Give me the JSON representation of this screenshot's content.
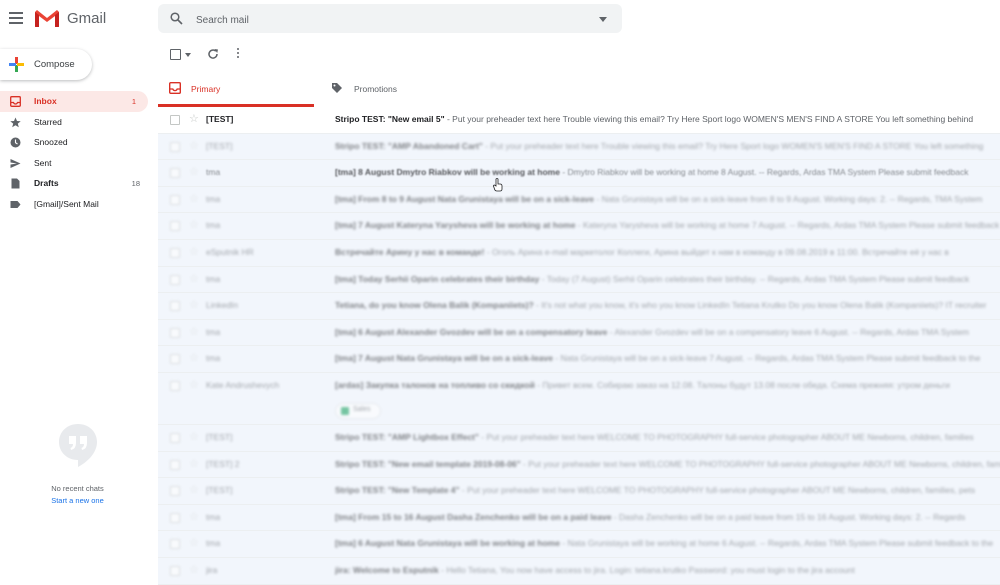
{
  "header": {
    "app_name": "Gmail",
    "search_placeholder": "Search mail"
  },
  "sidebar": {
    "compose_label": "Compose",
    "items": [
      {
        "label": "Inbox",
        "count": "1",
        "icon": "inbox-icon"
      },
      {
        "label": "Starred",
        "count": "",
        "icon": "star-icon"
      },
      {
        "label": "Snoozed",
        "count": "",
        "icon": "clock-icon"
      },
      {
        "label": "Sent",
        "count": "",
        "icon": "send-icon"
      },
      {
        "label": "Drafts",
        "count": "18",
        "icon": "file-icon"
      },
      {
        "label": "[Gmail]/Sent Mail",
        "count": "",
        "icon": "label-icon"
      }
    ],
    "chat": {
      "empty_text": "No recent chats",
      "link_text": "Start a new one"
    }
  },
  "tabs": [
    {
      "label": "Primary",
      "icon": "inbox-icon"
    },
    {
      "label": "Promotions",
      "icon": "tag-icon"
    }
  ],
  "colors": {
    "accent": "#d93025",
    "link": "#1a73e8",
    "active_bg": "#fce8e6"
  },
  "emails": [
    {
      "sender": "[TEST]",
      "subject": "Stripo TEST: \"New email 5\"",
      "snippet": " - Put your preheader text here Trouble viewing this email? Try Here Sport logo WOMEN'S MEN'S FIND A STORE You left something behind"
    },
    {
      "sender": "[TEST]",
      "subject": "Stripo TEST: \"AMP Abandoned Cart\"",
      "snippet": " - Put your preheader text here Trouble viewing this email? Try Here Sport logo WOMEN'S MEN'S FIND A STORE You left something"
    },
    {
      "sender": "tma",
      "subject": "[tma] 8 August Dmytro Riabkov will be working at home",
      "snippet": " - Dmytro Riabkov will be working at home 8 August. -- Regards, Ardas TMA System Please submit feedback"
    },
    {
      "sender": "tma",
      "subject": "[tma] From 8 to 9 August Nata Grunistaya will be on a sick-leave",
      "snippet": " - Nata Grunistaya will be on a sick-leave from 8 to 9 August. Working days: 2. -- Regards, TMA System"
    },
    {
      "sender": "tma",
      "subject": "[tma] 7 August Kateryna Yarysheva will be working at home",
      "snippet": " - Kateryna Yarysheva will be working at home 7 August. -- Regards, Ardas TMA System Please submit feedback"
    },
    {
      "sender": "eSputnik HR",
      "subject": "Встречайте Арину у нас в команде!",
      "snippet": " - Оголь Арина e-mail маркетолог Коллеги, Арина выйдет к нам в команду в 09.08.2019 в 11:00. Встречайте её у нас в"
    },
    {
      "sender": "tma",
      "subject": "[tma] Today Serhii Oparin celebrates their birthday",
      "snippet": " - Today (7 August) Serhii Oparin celebrates their birthday. -- Regards, Ardas TMA System Please submit feedback"
    },
    {
      "sender": "LinkedIn",
      "subject": "Tetiana, do you know Olena Balik (Kompaniiets)?",
      "snippet": " - It's not what you know, it's who you know LinkedIn Tetiana Krutko Do you know Olena Balik (Kompaniiets)? IT recruiter"
    },
    {
      "sender": "tma",
      "subject": "[tma] 6 August Alexander Gvozdev will be on a compensatory leave",
      "snippet": " - Alexander Gvozdev will be on a compensatory leave 6 August. -- Regards, Ardas TMA System"
    },
    {
      "sender": "tma",
      "subject": "[tma] 7 August Nata Grunistaya will be on a sick-leave",
      "snippet": " - Nata Grunistaya will be on a sick-leave 7 August. -- Regards, Ardas TMA System Please submit feedback to the"
    },
    {
      "sender": "Kate Andrushevych",
      "subject": "[ardas] Закупка талонов на топливо со скидкой",
      "snippet": " - Привет всем. Собираю заказ на 12.08. Талоны будут 13.08 после обеда. Схема прежняя: утром деньги",
      "attachment": "Sales"
    },
    {
      "sender": "[TEST]",
      "subject": "Stripo TEST: \"AMP Lightbox Effect\"",
      "snippet": " - Put your preheader text here WELCOME TO PHOTOGRAPHY full-service photographer ABOUT ME Newborns, children, families"
    },
    {
      "sender": "[TEST] 2",
      "subject": "Stripo TEST: \"New email template 2019-08-06\"",
      "snippet": " - Put your preheader text here WELCOME TO PHOTOGRAPHY full-service photographer ABOUT ME Newborns, children, families"
    },
    {
      "sender": "[TEST]",
      "subject": "Stripo TEST: \"New Template 4\"",
      "snippet": " - Put your preheader text here WELCOME TO PHOTOGRAPHY full-service photographer ABOUT ME Newborns, children, families, pets"
    },
    {
      "sender": "tma",
      "subject": "[tma] From 15 to 16 August Dasha Zenchenko will be on a paid leave",
      "snippet": " - Dasha Zenchenko will be on a paid leave from 15 to 16 August. Working days: 2. -- Regards"
    },
    {
      "sender": "tma",
      "subject": "[tma] 6 August Nata Grunistaya will be working at home",
      "snippet": " - Nata Grunistaya will be working at home 6 August. -- Regards, Ardas TMA System Please submit feedback to the"
    },
    {
      "sender": "jira",
      "subject": "jira: Welcome to Esputnik",
      "snippet": " - Hello Tetiana, You now have access to jira. Login: tetiana.krutko Password: you must login to the jira account"
    }
  ]
}
